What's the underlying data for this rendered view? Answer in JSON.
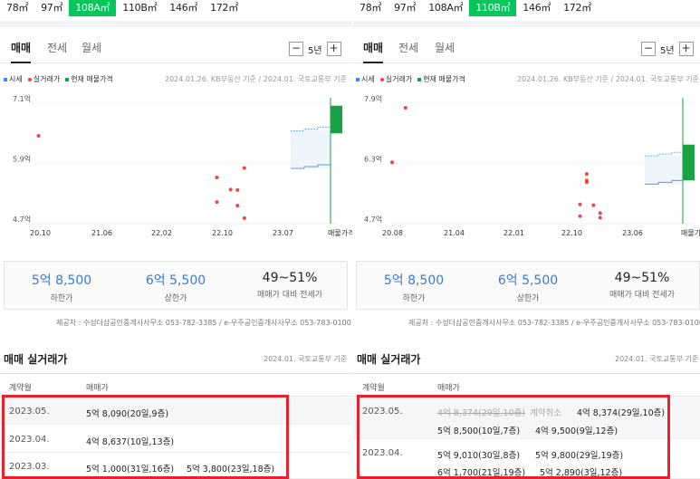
{
  "left": {
    "sizes": [
      {
        "label": "78㎡",
        "active": false
      },
      {
        "label": "97㎡",
        "active": false
      },
      {
        "label": "108A㎡",
        "active": true
      },
      {
        "label": "110B㎡",
        "active": false
      },
      {
        "label": "146㎡",
        "active": false
      },
      {
        "label": "172㎡",
        "active": false
      }
    ],
    "tabs": [
      "매매",
      "전세",
      "월세"
    ],
    "period": {
      "minus": "−",
      "value": "5년",
      "plus": "+"
    },
    "legend": {
      "market": "시세",
      "actual": "실거래가",
      "current": "현재 매물가격"
    },
    "source": "2024.01.26. KB부동산 기준 / 2024.01. 국토교통부 기준",
    "chart_data": {
      "type": "scatter",
      "y_ticks": [
        "7.1억",
        "5.9억",
        "4.7억"
      ],
      "ylim": [
        4.7,
        7.1
      ],
      "x_ticks": [
        "20.10",
        "21.06",
        "22.02",
        "22.10",
        "23.07",
        "매물가격"
      ],
      "actual_points": [
        {
          "x": "2020.11",
          "y": 6.45
        },
        {
          "x": "2023.01",
          "y": 5.62
        },
        {
          "x": "2023.01",
          "y": 5.13
        },
        {
          "x": "2023.03",
          "y": 5.38
        },
        {
          "x": "2023.04",
          "y": 5.06
        },
        {
          "x": "2023.04",
          "y": 5.37
        },
        {
          "x": "2023.05",
          "y": 4.81
        },
        {
          "x": "2023.05",
          "y": 5.81
        }
      ],
      "market_band": {
        "low": 5.8,
        "high": 6.55
      },
      "listing_range": {
        "low": 6.5,
        "high": 7.05
      }
    },
    "stats": [
      {
        "value": "5억 8,500",
        "label": "하한가"
      },
      {
        "value": "6억 5,500",
        "label": "상한가"
      },
      {
        "value": "49~51%",
        "label": "매매가 대비 전세가"
      }
    ],
    "notice": "제공처 : 수성더샵공인중개사사무소 053-782-3385 / e-우주공인중개사사무소 053-783-0100",
    "section_title": "매매 실거래가",
    "section_source": "2024.01. 국토교통부 기준",
    "table_headers": [
      "계약월",
      "매매가"
    ],
    "rows": [
      {
        "month": "2023.05.",
        "deals": [
          "5억 8,090(20일,9층)"
        ]
      },
      {
        "month": "2023.04.",
        "deals": [
          "4억 8,637(10일,13층)"
        ]
      },
      {
        "month": "2023.03.",
        "deals": [
          "5억 1,000(31일,16층)",
          "5억 3,800(23일,18층)"
        ]
      }
    ]
  },
  "right": {
    "sizes": [
      {
        "label": "78㎡",
        "active": false
      },
      {
        "label": "97㎡",
        "active": false
      },
      {
        "label": "108A㎡",
        "active": false
      },
      {
        "label": "110B㎡",
        "active": true
      },
      {
        "label": "146㎡",
        "active": false
      },
      {
        "label": "172㎡",
        "active": false
      }
    ],
    "tabs": [
      "매매",
      "전세",
      "월세"
    ],
    "period": {
      "minus": "−",
      "value": "5년",
      "plus": "+"
    },
    "legend": {
      "market": "시세",
      "actual": "실거래가",
      "current": "현재 매물가격"
    },
    "source": "2024.01.26. KB부동산 기준 / 2024.01. 국토교통부 기준",
    "chart_data": {
      "type": "scatter",
      "y_ticks": [
        "7.9억",
        "6.3억",
        "4.7억"
      ],
      "ylim": [
        4.7,
        7.9
      ],
      "x_ticks": [
        "20.08",
        "21.04",
        "22.01",
        "22.10",
        "23.06",
        "매물가"
      ],
      "actual_points": [
        {
          "x": "2020.08",
          "y": 6.33
        },
        {
          "x": "2020.10",
          "y": 7.78
        },
        {
          "x": "2022.12",
          "y": 5.21
        },
        {
          "x": "2022.12",
          "y": 4.9
        },
        {
          "x": "2023.01",
          "y": 6.02
        },
        {
          "x": "2023.01",
          "y": 5.85
        },
        {
          "x": "2023.01",
          "y": 5.8
        },
        {
          "x": "2023.02",
          "y": 5.19
        },
        {
          "x": "2023.03",
          "y": 4.98
        },
        {
          "x": "2023.03",
          "y": 4.86
        }
      ],
      "market_band": {
        "low": 5.75,
        "high": 6.5
      },
      "listing_range": {
        "low": 5.85,
        "high": 6.8
      }
    },
    "stats": [
      {
        "value": "5억 8,500",
        "label": "하한가"
      },
      {
        "value": "6억 5,500",
        "label": "상한가"
      },
      {
        "value": "49~51%",
        "label": "매매가 대비 전세가"
      }
    ],
    "notice": "제공처 : 수성더샵공인중개사사무소 053-782-3385 / e-우주공인중개사사무소 053-783-0100",
    "section_title": "매매 실거래가",
    "section_source": "2024.01. 국토교통부 기준",
    "table_headers": [
      "계약월",
      "매매가"
    ],
    "rows": [
      {
        "month": "2023.05.",
        "cancelled": "4억 8,374(29일,10층)",
        "cancel_label": "계약취소",
        "deals": [
          "4억 8,374(29일,10층)",
          "5억 8,500(10일,7층)",
          "4억 9,500(9일,12층)"
        ]
      },
      {
        "month": "2023.04.",
        "deals": [
          "5억 9,010(30일,8층)",
          "5억 9,800(29일,19층)",
          "6억 1,700(21일,19층)",
          "5억 2,890(3일,12층)"
        ]
      }
    ]
  }
}
